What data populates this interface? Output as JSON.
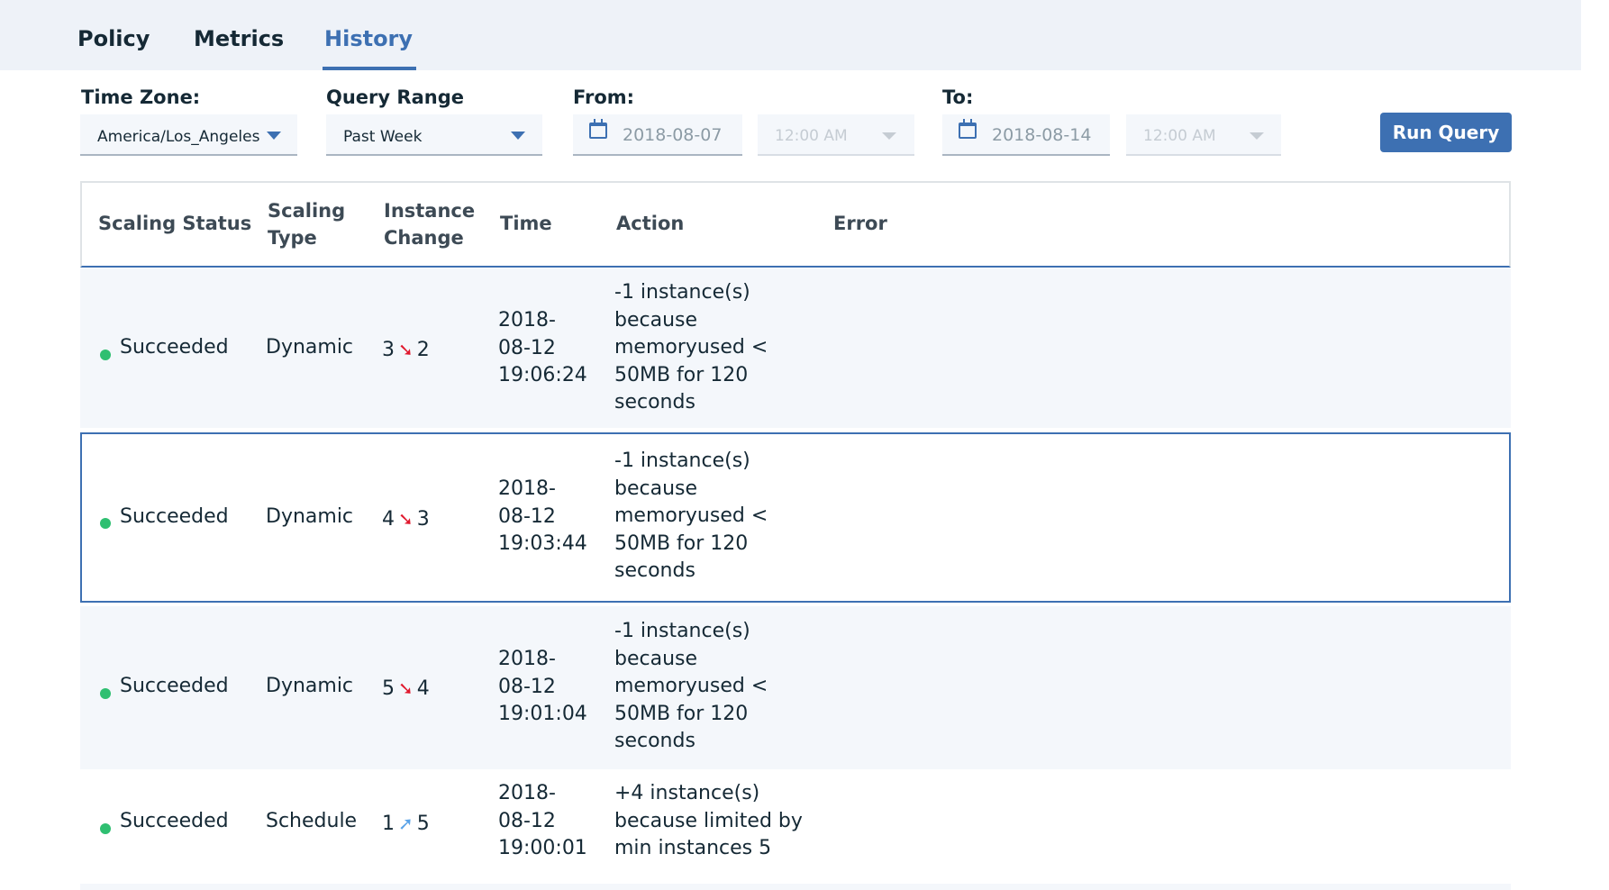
{
  "tabs": {
    "policy": "Policy",
    "metrics": "Metrics",
    "history": "History"
  },
  "filters": {
    "time_zone_label": "Time Zone:",
    "time_zone_value": "America/Los_Angeles",
    "query_range_label": "Query Range",
    "query_range_value": "Past Week",
    "from_label": "From:",
    "from_date": "2018-08-07",
    "from_time": "12:00 AM",
    "to_label": "To:",
    "to_date": "2018-08-14",
    "to_time": "12:00 AM",
    "run_button": "Run Query"
  },
  "table": {
    "headers": {
      "status": "Scaling Status",
      "type_line1": "Scaling",
      "type_line2": "Type",
      "change_line1": "Instance",
      "change_line2": "Change",
      "time": "Time",
      "action": "Action",
      "error": "Error"
    },
    "rows": [
      {
        "status": "Succeeded",
        "type": "Dynamic",
        "from": "3",
        "to": "2",
        "direction": "down",
        "time_1": "2018-",
        "time_2": "08-12",
        "time_3": "19:06:24",
        "action_1": "-1 instance(s)",
        "action_2": "because",
        "action_3": "memoryused <",
        "action_4": "50MB for 120",
        "action_5": "seconds"
      },
      {
        "status": "Succeeded",
        "type": "Dynamic",
        "from": "4",
        "to": "3",
        "direction": "down",
        "time_1": "2018-",
        "time_2": "08-12",
        "time_3": "19:03:44",
        "action_1": "-1 instance(s)",
        "action_2": "because",
        "action_3": "memoryused <",
        "action_4": "50MB for 120",
        "action_5": "seconds"
      },
      {
        "status": "Succeeded",
        "type": "Dynamic",
        "from": "5",
        "to": "4",
        "direction": "down",
        "time_1": "2018-",
        "time_2": "08-12",
        "time_3": "19:01:04",
        "action_1": "-1 instance(s)",
        "action_2": "because",
        "action_3": "memoryused <",
        "action_4": "50MB for 120",
        "action_5": "seconds"
      },
      {
        "status": "Succeeded",
        "type": "Schedule",
        "from": "1",
        "to": "5",
        "direction": "up",
        "time_1": "2018-",
        "time_2": "08-12",
        "time_3": "19:00:01",
        "action_1": "+4 instance(s)",
        "action_2": "because limited by",
        "action_3": "min instances 5"
      }
    ]
  },
  "colors": {
    "accent": "#3d70b2",
    "success": "#2fbf71",
    "arrow_down": "#e0182d",
    "arrow_up": "#5aa3e8"
  },
  "icons": {
    "calendar": "calendar-icon",
    "dropdown": "chevron-down-icon",
    "status": "status-dot-icon",
    "down": "arrow-down-right-icon",
    "up": "arrow-up-right-icon"
  }
}
